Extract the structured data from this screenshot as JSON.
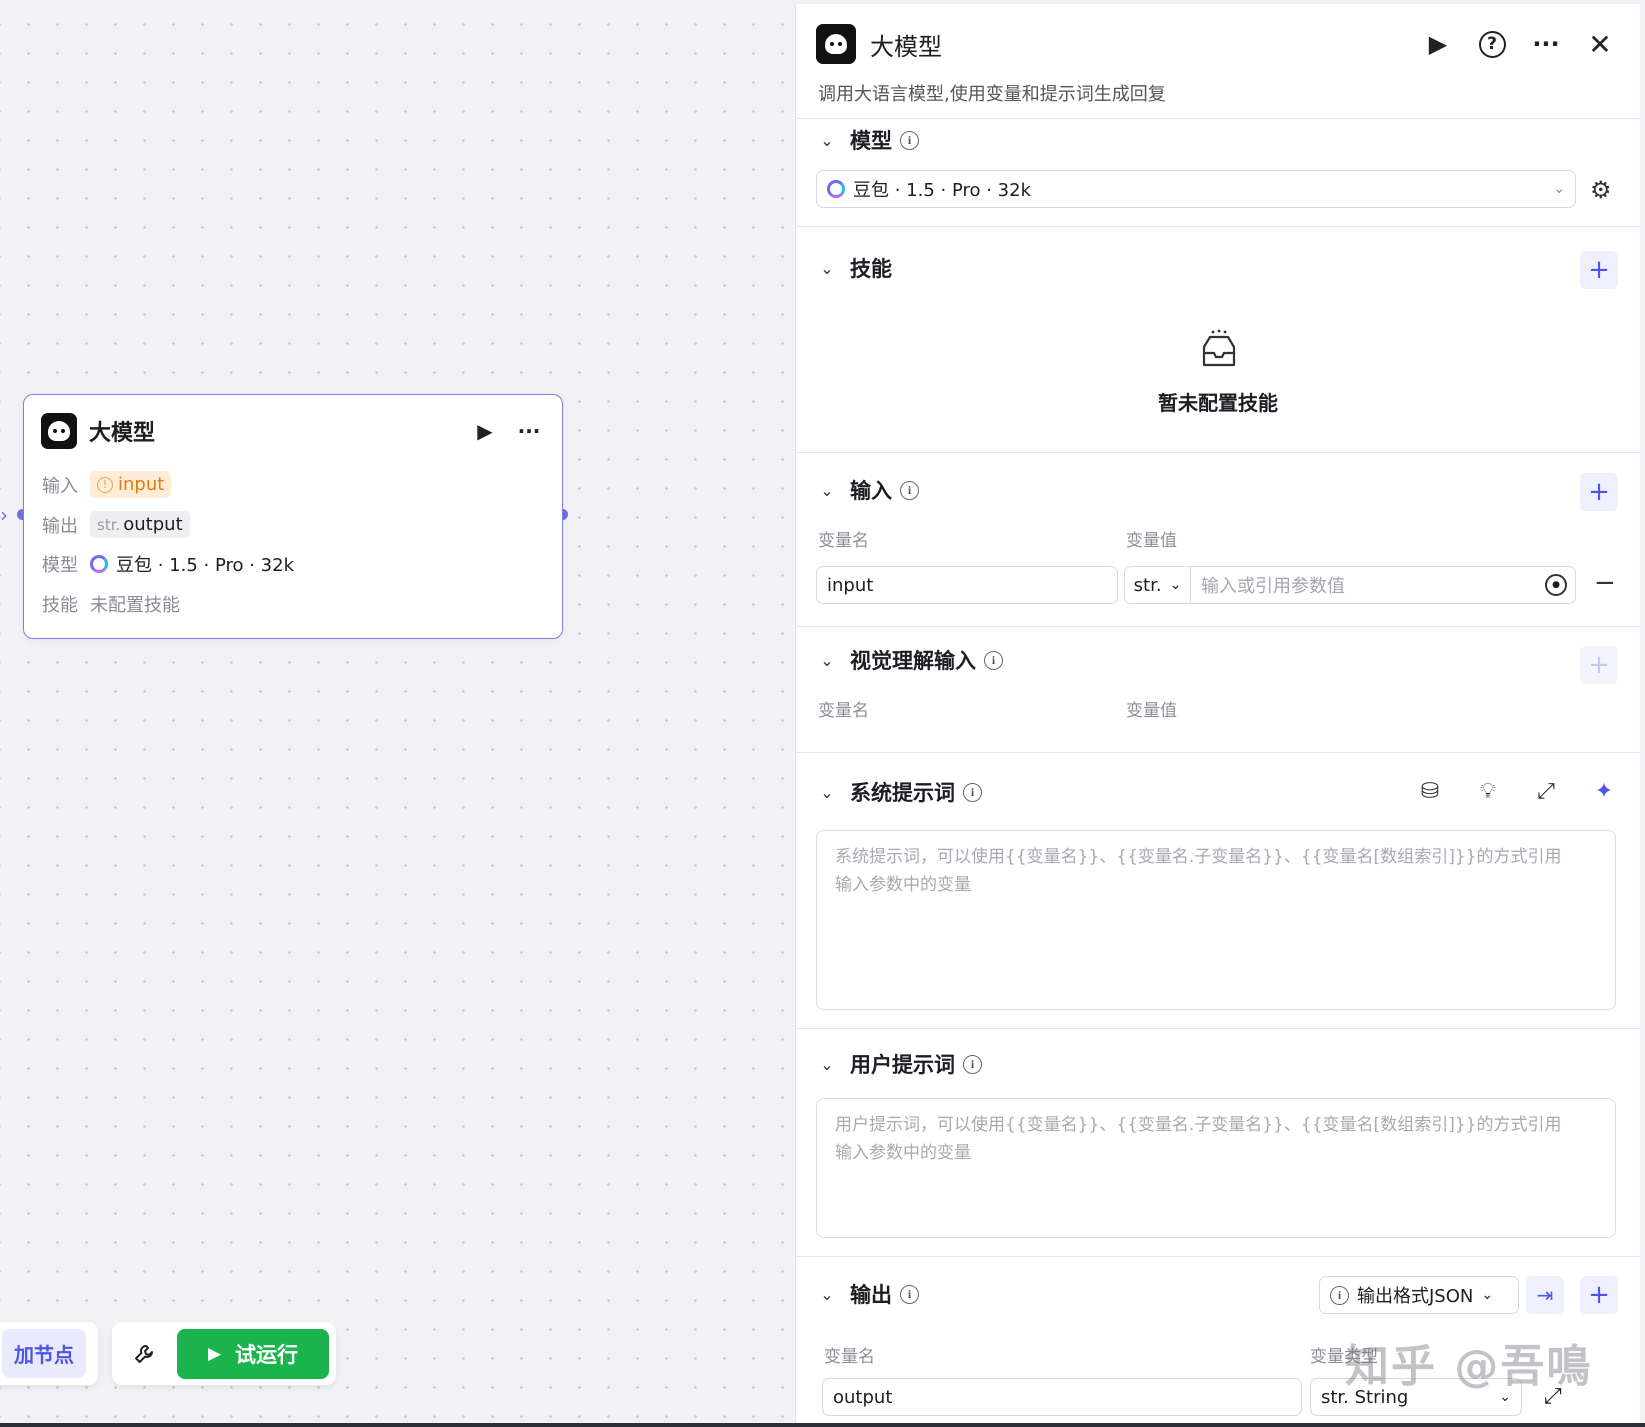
{
  "node": {
    "title": "大模型",
    "rows": {
      "input_label": "输入",
      "input_value": "input",
      "output_label": "输出",
      "output_type": "str.",
      "output_value": "output",
      "model_label": "模型",
      "model_value": "豆包 · 1.5 · Pro · 32k",
      "skill_label": "技能",
      "skill_value": "未配置技能"
    }
  },
  "toolbar": {
    "add_node": "加节点",
    "run": "试运行"
  },
  "panel": {
    "title": "大模型",
    "description": "调用大语言模型,使用变量和提示词生成回复",
    "model_section": {
      "title": "模型",
      "selected": "豆包 · 1.5 · Pro · 32k"
    },
    "skill_section": {
      "title": "技能",
      "empty": "暂未配置技能"
    },
    "input_section": {
      "title": "输入",
      "col_name": "变量名",
      "col_value": "变量值",
      "name_value": "input",
      "type": "str.",
      "value_placeholder": "输入或引用参数值"
    },
    "vision_section": {
      "title": "视觉理解输入",
      "col_name": "变量名",
      "col_value": "变量值"
    },
    "system_prompt": {
      "title": "系统提示词",
      "placeholder_line1": "系统提示词，可以使用{{变量名}}、{{变量名.子变量名}}、{{变量名[数组索引]}}的方式引用",
      "placeholder_line2": "输入参数中的变量"
    },
    "user_prompt": {
      "title": "用户提示词",
      "placeholder_line1": "用户提示词，可以使用{{变量名}}、{{变量名.子变量名}}、{{变量名[数组索引]}}的方式引用",
      "placeholder_line2": "输入参数中的变量"
    },
    "output_section": {
      "title": "输出",
      "format": "输出格式JSON",
      "col_name": "变量名",
      "col_type": "变量类型",
      "name_value": "output",
      "type_value": "str. String"
    }
  },
  "watermark": "知乎 @吾鳴",
  "colors": {
    "accent": "#4d55e8",
    "run_green": "#1bb44c",
    "node_border": "#7d80e8",
    "warn": "#e07d10"
  }
}
